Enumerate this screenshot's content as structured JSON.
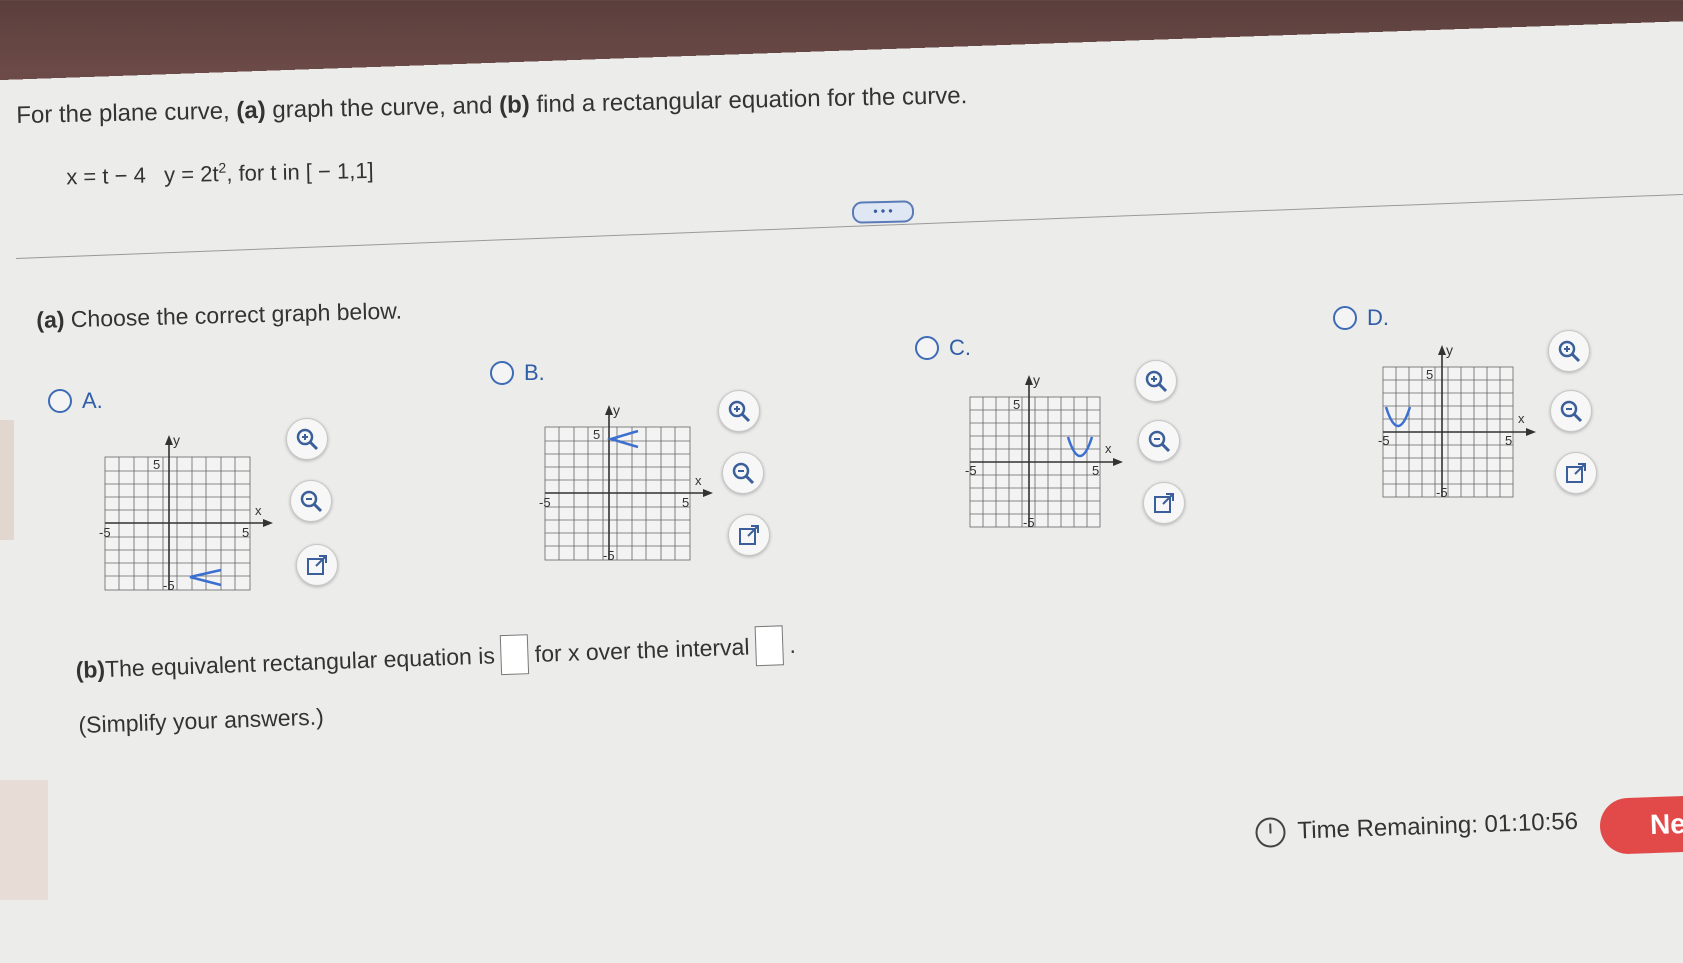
{
  "question": {
    "prefix": "For the plane curve, ",
    "part_a_tag": "(a)",
    "mid1": " graph the curve, and ",
    "part_b_tag": "(b)",
    "suffix": " find a rectangular equation for the curve."
  },
  "equation": {
    "x_text": "x = t − 4",
    "y_text_pre": "y = 2t",
    "y_exp": "2",
    "range_text": ", for t in [ − 1,1]"
  },
  "more_button": "• • •",
  "part_a": {
    "tag": "(a)",
    "text": " Choose the correct graph below."
  },
  "options": [
    {
      "letter": "A."
    },
    {
      "letter": "B."
    },
    {
      "letter": "C."
    },
    {
      "letter": "D."
    }
  ],
  "graph_labels": {
    "y": "y",
    "x": "x",
    "pos5": "5",
    "neg5": "-5"
  },
  "part_b": {
    "tag": "(b)",
    "text1": " The equivalent rectangular equation is",
    "text2": "for x over the interval",
    "end": ".",
    "simplify": "(Simplify your answers.)"
  },
  "timer": {
    "label": "Time Remaining: 01:10:56"
  },
  "next_button": "Ne",
  "colors": {
    "accent": "#2f5ea8",
    "curve": "#3b6fd0",
    "next": "#e24a4a"
  }
}
